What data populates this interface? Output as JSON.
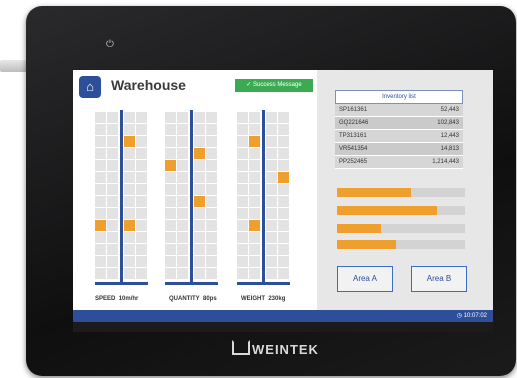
{
  "header": {
    "title": "Warehouse",
    "success_message": "Success Message",
    "power_icon": "power-icon",
    "home_icon": "home-icon"
  },
  "inventory": {
    "title": "Inventory list",
    "rows": [
      {
        "code": "SP161361",
        "value": "52,443"
      },
      {
        "code": "GQ221646",
        "value": "102,843"
      },
      {
        "code": "TP313161",
        "value": "12,443"
      },
      {
        "code": "VR541354",
        "value": "14,813"
      },
      {
        "code": "PP252465",
        "value": "1,214,443"
      }
    ]
  },
  "progress": [
    0.58,
    0.78,
    0.34,
    0.46
  ],
  "buttons": {
    "area_a": "Area A",
    "area_b": "Area B"
  },
  "gauges": [
    {
      "label": "SPEED",
      "value": "10m/hr"
    },
    {
      "label": "QUANTITY",
      "value": "80ps"
    },
    {
      "label": "WEIGHT",
      "value": "230kg"
    }
  ],
  "status": {
    "time": "10:07:02"
  },
  "brand": "WEINTEK",
  "colors": {
    "accent": "#2d4f9a",
    "highlight": "#ef9f2d",
    "success": "#3bab52"
  }
}
